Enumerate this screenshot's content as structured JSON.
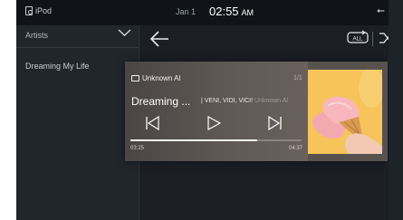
{
  "status": {
    "source_label": "iPod",
    "date": "Jan 1",
    "time": "02:55",
    "ampm": "AM",
    "usb_icon": "usb-icon"
  },
  "sidebar": {
    "category": "Artists",
    "items": [
      {
        "label": "Dreaming My Life"
      }
    ]
  },
  "player": {
    "folder": "Unknown Al",
    "count": "1/1",
    "title": "Dreaming ...",
    "artist": "VENI, VIDI, VICI!",
    "album": "Unknown Al",
    "elapsed": "03:25",
    "total": "04:37",
    "progress": 0.74,
    "repeat_label": "ALL"
  },
  "colors": {
    "accent": "#ffffff",
    "card": "#58524f",
    "background": "#1b1f25"
  }
}
